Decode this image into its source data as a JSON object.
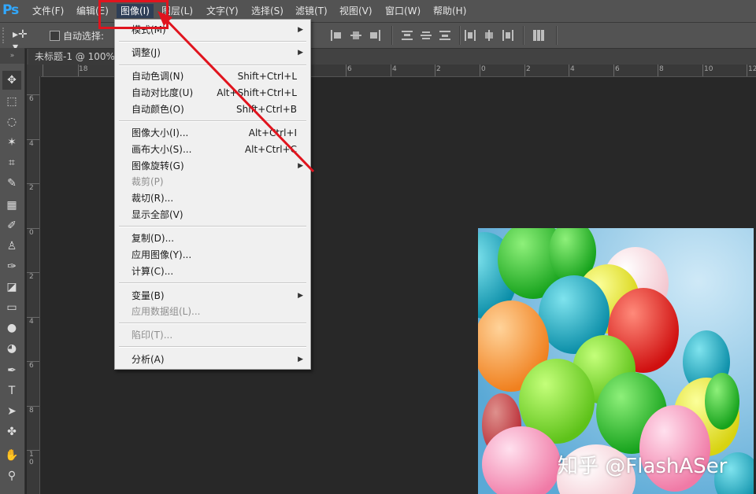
{
  "app": {
    "logo": "Ps"
  },
  "menubar": {
    "items": [
      {
        "label": "文件(F)"
      },
      {
        "label": "编辑(E)"
      },
      {
        "label": "图像(I)"
      },
      {
        "label": "图层(L)"
      },
      {
        "label": "文字(Y)"
      },
      {
        "label": "选择(S)"
      },
      {
        "label": "滤镜(T)"
      },
      {
        "label": "视图(V)"
      },
      {
        "label": "窗口(W)"
      },
      {
        "label": "帮助(H)"
      }
    ]
  },
  "options": {
    "auto_select_label": "自动选择:"
  },
  "document": {
    "tab_title": "未标题-1 @ 100%"
  },
  "ruler": {
    "top": [
      "18",
      "6",
      "4",
      "2",
      "0",
      "2",
      "4",
      "6",
      "8",
      "10",
      "12"
    ],
    "left": [
      "6",
      "4",
      "2",
      "0",
      "2",
      "4",
      "6",
      "8",
      "1\n0"
    ]
  },
  "image_menu": {
    "items": [
      {
        "label": "模式(M)",
        "shortcut": "",
        "submenu": true,
        "disabled": false
      },
      {
        "label": "调整(J)",
        "shortcut": "",
        "submenu": true,
        "disabled": false
      },
      {
        "label": "自动色调(N)",
        "shortcut": "Shift+Ctrl+L",
        "submenu": false,
        "disabled": false
      },
      {
        "label": "自动对比度(U)",
        "shortcut": "Alt+Shift+Ctrl+L",
        "submenu": false,
        "disabled": false
      },
      {
        "label": "自动颜色(O)",
        "shortcut": "Shift+Ctrl+B",
        "submenu": false,
        "disabled": false
      },
      {
        "label": "图像大小(I)...",
        "shortcut": "Alt+Ctrl+I",
        "submenu": false,
        "disabled": false
      },
      {
        "label": "画布大小(S)...",
        "shortcut": "Alt+Ctrl+C",
        "submenu": false,
        "disabled": false
      },
      {
        "label": "图像旋转(G)",
        "shortcut": "",
        "submenu": true,
        "disabled": false
      },
      {
        "label": "裁剪(P)",
        "shortcut": "",
        "submenu": false,
        "disabled": true
      },
      {
        "label": "裁切(R)...",
        "shortcut": "",
        "submenu": false,
        "disabled": false
      },
      {
        "label": "显示全部(V)",
        "shortcut": "",
        "submenu": false,
        "disabled": false
      },
      {
        "label": "复制(D)...",
        "shortcut": "",
        "submenu": false,
        "disabled": false
      },
      {
        "label": "应用图像(Y)...",
        "shortcut": "",
        "submenu": false,
        "disabled": false
      },
      {
        "label": "计算(C)...",
        "shortcut": "",
        "submenu": false,
        "disabled": false
      },
      {
        "label": "变量(B)",
        "shortcut": "",
        "submenu": true,
        "disabled": false
      },
      {
        "label": "应用数据组(L)...",
        "shortcut": "",
        "submenu": false,
        "disabled": true
      },
      {
        "label": "陷印(T)...",
        "shortcut": "",
        "submenu": false,
        "disabled": true
      },
      {
        "label": "分析(A)",
        "shortcut": "",
        "submenu": true,
        "disabled": false
      }
    ]
  },
  "watermark": "知乎 @FlashASer",
  "colors": {
    "annotation": "#e0141e",
    "menu_active": "#2e3e56",
    "ps_blue": "#31a8ff"
  }
}
